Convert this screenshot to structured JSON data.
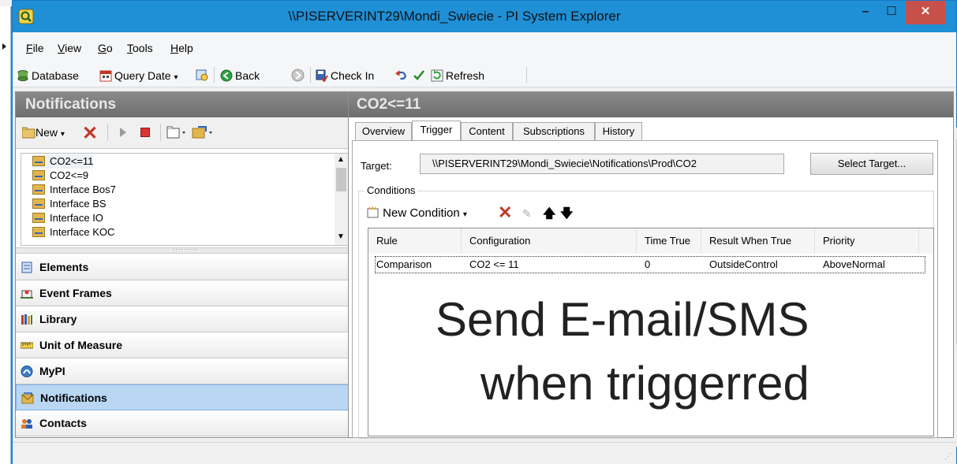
{
  "window": {
    "title": "\\\\PISERVERINT29\\Mondi_Swiecie - PI System Explorer",
    "min": "–",
    "max": "☐",
    "close": "✕"
  },
  "menu": [
    {
      "label": "File",
      "key": "F",
      "rest": "ile"
    },
    {
      "label": "View",
      "key": "V",
      "rest": "iew"
    },
    {
      "label": "Go",
      "key": "G",
      "rest": "o"
    },
    {
      "label": "Tools",
      "key": "T",
      "rest": "ools"
    },
    {
      "label": "Help",
      "key": "H",
      "rest": "elp"
    }
  ],
  "toolbar": {
    "database": "Database",
    "query_date": "Query Date",
    "back": "Back",
    "check_in": "Check In",
    "refresh": "Refresh"
  },
  "left": {
    "header": "Notifications",
    "new_label": "New",
    "list": [
      "CO2<=11",
      "CO2<=9",
      "Interface Bos7",
      "Interface BS",
      "Interface IO",
      "Interface KOC"
    ],
    "nav": [
      "Elements",
      "Event Frames",
      "Library",
      "Unit of Measure",
      "MyPI",
      "Notifications",
      "Contacts"
    ],
    "selected_nav": "Notifications"
  },
  "right": {
    "header": "CO2<=11",
    "tabs": [
      "Overview",
      "Trigger",
      "Content",
      "Subscriptions",
      "History"
    ],
    "active_tab": "Trigger",
    "target_label": "Target:",
    "target_value": "\\\\PISERVERINT29\\Mondi_Swiecie\\Notifications\\Prod\\CO2",
    "select_target": "Select Target...",
    "conditions_label": "Conditions",
    "new_condition": "New Condition",
    "columns": [
      "Rule",
      "Configuration",
      "Time True",
      "Result When True",
      "Priority"
    ],
    "rows": [
      {
        "rule": "Comparison",
        "configuration": "CO2 <= 11",
        "time_true": "0",
        "result": "OutsideControl",
        "priority": "AboveNormal"
      }
    ]
  },
  "overlay": {
    "line1": "Send E-mail/SMS",
    "line2": "when triggerred"
  },
  "colors": {
    "accent": "#1f8fd6",
    "close": "#c7514a",
    "header_gray": "#7c7c7c",
    "selected_nav": "#b9d7f3"
  }
}
